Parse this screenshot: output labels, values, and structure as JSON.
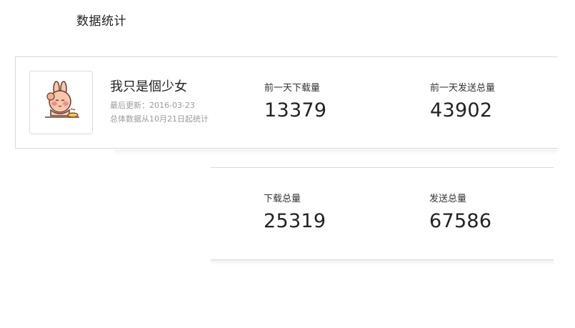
{
  "page_title": "数据统计",
  "profile": {
    "name": "我只是個少女",
    "last_update": "最后更新：2016-03-23",
    "stats_note": "总体数据从10月21日起统计"
  },
  "stats_top": {
    "downloads_yesterday_label": "前一天下载量",
    "downloads_yesterday_value": "13379",
    "sends_yesterday_label": "前一天发送总量",
    "sends_yesterday_value": "43902"
  },
  "stats_bottom": {
    "downloads_total_label": "下载总量",
    "downloads_total_value": "25319",
    "sends_total_label": "发送总量",
    "sends_total_value": "67586"
  },
  "avatar_icon": "bunny-sticker-icon"
}
